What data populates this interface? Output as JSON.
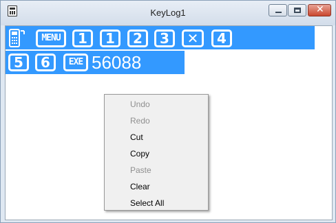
{
  "window": {
    "title": "KeyLog1"
  },
  "window_controls": {
    "minimize": "minimize",
    "maximize": "maximize",
    "close": "close"
  },
  "content": {
    "line1_keys": [
      "MENU",
      "1",
      "1",
      "2",
      "3",
      "4"
    ],
    "line2_keys": [
      "5",
      "6",
      "EXE"
    ],
    "result_text": "56088",
    "selection_color": "#3399ff"
  },
  "context_menu": {
    "items": [
      {
        "label": "Undo",
        "enabled": false
      },
      {
        "label": "Redo",
        "enabled": false
      },
      {
        "label": "Cut",
        "enabled": true
      },
      {
        "label": "Copy",
        "enabled": true
      },
      {
        "label": "Paste",
        "enabled": false
      },
      {
        "label": "Clear",
        "enabled": true
      },
      {
        "label": "Select All",
        "enabled": true
      }
    ]
  }
}
